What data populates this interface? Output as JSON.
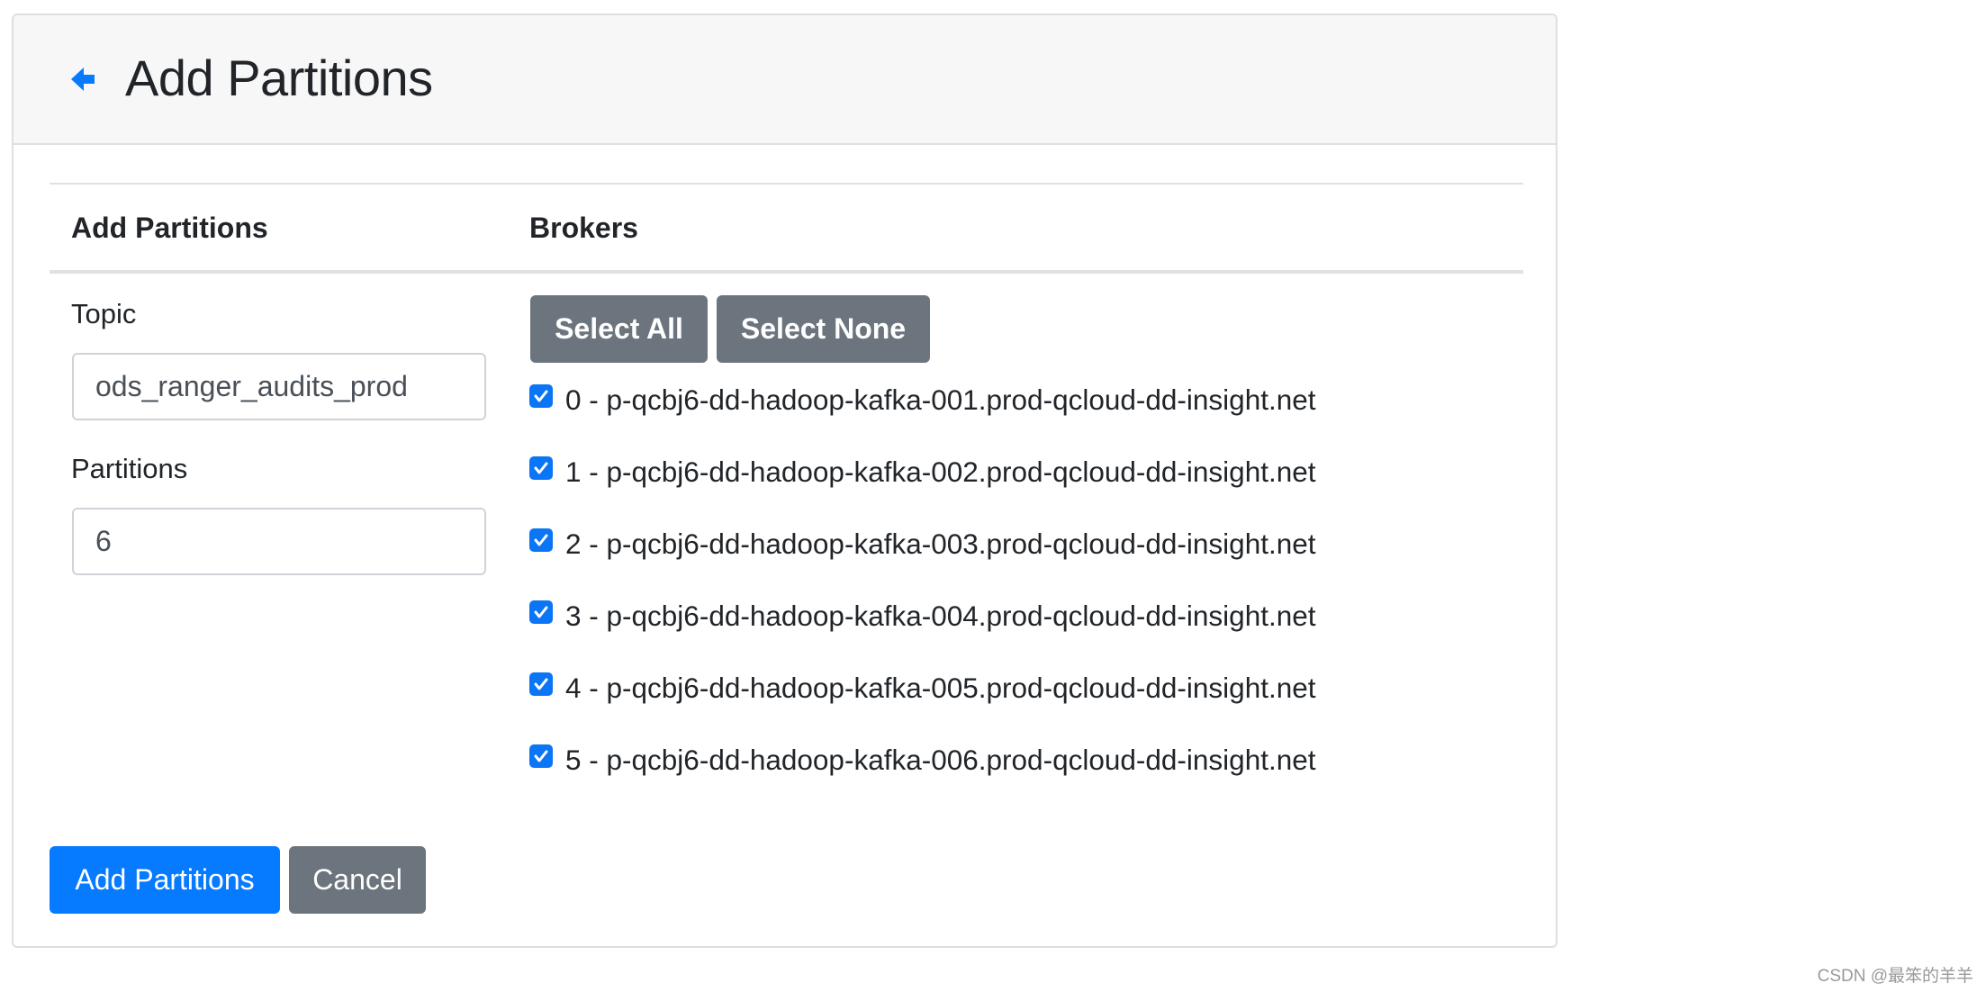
{
  "header": {
    "back_icon": "arrow-left-icon",
    "title": "Add Partitions"
  },
  "table": {
    "headers": [
      "Add Partitions",
      "Brokers"
    ]
  },
  "form": {
    "topic_label": "Topic",
    "topic_value": "ods_ranger_audits_prod",
    "partitions_label": "Partitions",
    "partitions_value": "6"
  },
  "brokers": {
    "select_all_label": "Select All",
    "select_none_label": "Select None",
    "items": [
      {
        "label": "0 - p-qcbj6-dd-hadoop-kafka-001.prod-qcloud-dd-insight.net",
        "checked": true
      },
      {
        "label": "1 - p-qcbj6-dd-hadoop-kafka-002.prod-qcloud-dd-insight.net",
        "checked": true
      },
      {
        "label": "2 - p-qcbj6-dd-hadoop-kafka-003.prod-qcloud-dd-insight.net",
        "checked": true
      },
      {
        "label": "3 - p-qcbj6-dd-hadoop-kafka-004.prod-qcloud-dd-insight.net",
        "checked": true
      },
      {
        "label": "4 - p-qcbj6-dd-hadoop-kafka-005.prod-qcloud-dd-insight.net",
        "checked": true
      },
      {
        "label": "5 - p-qcbj6-dd-hadoop-kafka-006.prod-qcloud-dd-insight.net",
        "checked": true
      }
    ]
  },
  "footer": {
    "submit_label": "Add Partitions",
    "cancel_label": "Cancel"
  },
  "colors": {
    "primary": "#077bff",
    "secondary": "#6c757d",
    "checkbox": "#0a75f5",
    "header_bg": "#f7f7f7"
  },
  "watermark": "CSDN @最笨的羊羊"
}
